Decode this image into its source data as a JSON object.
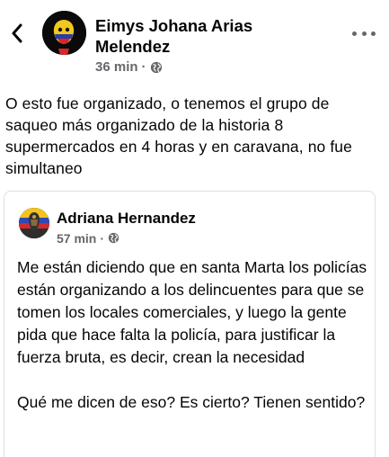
{
  "post": {
    "author": "Eimys Johana Arias Melendez",
    "time": "36 min",
    "separator": "·",
    "privacy_icon": "globe-icon",
    "text": "O esto fue organizado, o tenemos el grupo de saqueo más organizado de la historia 8 supermercados en 4 horas y en caravana, no fue simultaneo"
  },
  "shared": {
    "author": "Adriana Hernandez",
    "time": "57 min",
    "separator": "·",
    "privacy_icon": "globe-icon",
    "paragraphs": [
      "Me están diciendo que en santa Marta los policías están organizando a los delincuentes para que se tomen los locales comerciales, y luego la gente pida que hace falta la policía, para justificar la fuerza bruta, es decir, crean la necesidad",
      "Qué me dicen de eso? Es cierto? Tienen sentido?"
    ]
  },
  "colors": {
    "text": "#050505",
    "secondary": "#65676b",
    "border": "#dddfe2"
  }
}
